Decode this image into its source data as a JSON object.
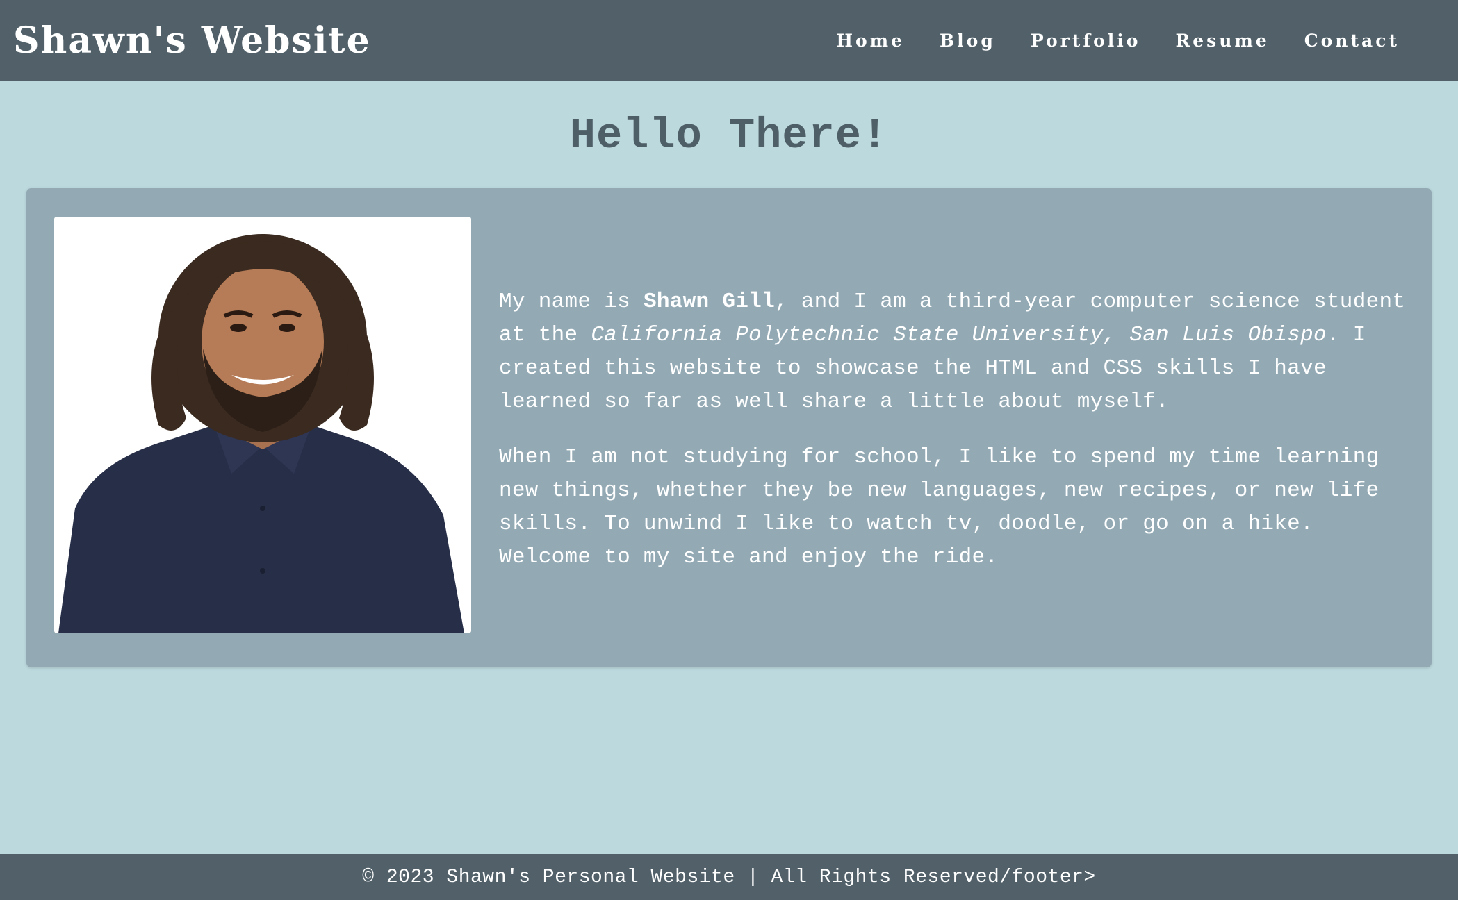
{
  "header": {
    "site_title": "Shawn's Website",
    "nav": [
      "Home",
      "Blog",
      "Portfolio",
      "Resume",
      "Contact"
    ]
  },
  "main": {
    "heading": "Hello There!",
    "intro": {
      "p1": {
        "pre": "My name is ",
        "name": "Shawn Gill",
        "mid": ", and I am a third-year computer science student at the ",
        "school": "California Polytechnic State University, San Luis Obispo",
        "post": ". I created this website to showcase the HTML and CSS skills I have learned so far as well share a little about myself."
      },
      "p2": "When I am not studying for school, I like to spend my time learning new things, whether they be new languages, new recipes, or new life skills. To unwind I like to watch tv, doodle, or go on a hike. Welcome to my site and enjoy the ride."
    }
  },
  "footer": {
    "text": "© 2023 Shawn's Personal Website | All Rights Reserved/footer>"
  },
  "colors": {
    "header_bg": "#516069",
    "page_bg": "#bcd9de",
    "card_bg": "#93aab5",
    "heading": "#4f5f68",
    "text": "#ffffff"
  }
}
